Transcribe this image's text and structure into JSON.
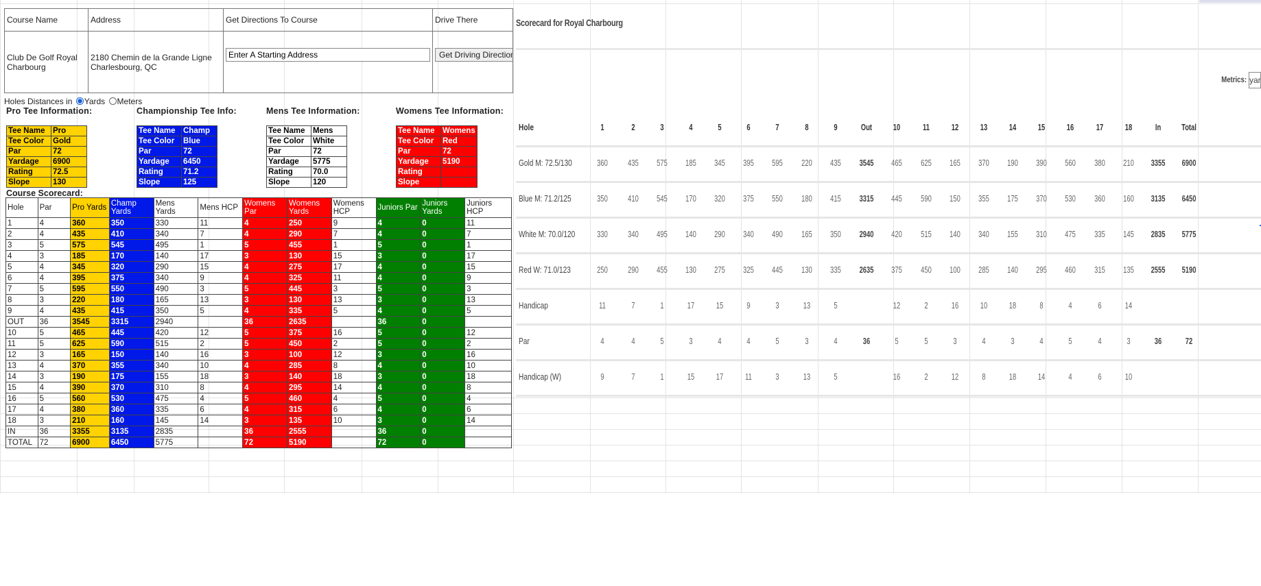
{
  "course_info": {
    "headers": [
      "Course Name",
      "Address",
      "Get Directions To Course",
      "Drive There"
    ],
    "course_name": "Club De Golf Royal Charbourg",
    "address_line1": "2180 Chemin de la Grande Ligne",
    "address_line2": "Charlesbourg, QC",
    "start_address_placeholder": "Enter A Starting Address",
    "directions_button": "Get Driving Directions"
  },
  "units": {
    "label": "Holes Distances in",
    "options": [
      "Yards",
      "Meters"
    ],
    "selected": "Yards"
  },
  "tees": [
    {
      "heading": "Pro Tee Information:",
      "color_class": "gold",
      "rows": [
        [
          "Tee Name",
          "Pro"
        ],
        [
          "Tee Color",
          "Gold"
        ],
        [
          "Par",
          "72"
        ],
        [
          "Yardage",
          "6900"
        ],
        [
          "Rating",
          "72.5"
        ],
        [
          "Slope",
          "130"
        ]
      ]
    },
    {
      "heading": "Championship Tee Info:",
      "color_class": "blue",
      "rows": [
        [
          "Tee Name",
          "Champ"
        ],
        [
          "Tee Color",
          "Blue"
        ],
        [
          "Par",
          "72"
        ],
        [
          "Yardage",
          "6450"
        ],
        [
          "Rating",
          "71.2"
        ],
        [
          "Slope",
          "125"
        ]
      ]
    },
    {
      "heading": "Mens Tee Information:",
      "color_class": "white",
      "rows": [
        [
          "Tee Name",
          "Mens"
        ],
        [
          "Tee Color",
          "White"
        ],
        [
          "Par",
          "72"
        ],
        [
          "Yardage",
          "5775"
        ],
        [
          "Rating",
          "70.0"
        ],
        [
          "Slope",
          "120"
        ]
      ]
    },
    {
      "heading": "Womens Tee Information:",
      "color_class": "red",
      "rows": [
        [
          "Tee Name",
          "Womens"
        ],
        [
          "Tee Color",
          "Red"
        ],
        [
          "Par",
          "72"
        ],
        [
          "Yardage",
          "5190"
        ],
        [
          "Rating",
          ""
        ],
        [
          "Slope",
          ""
        ]
      ]
    }
  ],
  "scorecard": {
    "title": "Course Scorecard:",
    "columns": [
      "Hole",
      "Par",
      "Pro Yards",
      "Champ Yards",
      "Mens Yards",
      "Mens HCP",
      "Womens Par",
      "Womens Yards",
      "Womens HCP",
      "Juniors Par",
      "Juniors Yards",
      "Juniors HCP"
    ],
    "rows": [
      [
        "1",
        "4",
        "360",
        "350",
        "330",
        "11",
        "4",
        "250",
        "9",
        "4",
        "0",
        "11"
      ],
      [
        "2",
        "4",
        "435",
        "410",
        "340",
        "7",
        "4",
        "290",
        "7",
        "4",
        "0",
        "7"
      ],
      [
        "3",
        "5",
        "575",
        "545",
        "495",
        "1",
        "5",
        "455",
        "1",
        "5",
        "0",
        "1"
      ],
      [
        "4",
        "3",
        "185",
        "170",
        "140",
        "17",
        "3",
        "130",
        "15",
        "3",
        "0",
        "17"
      ],
      [
        "5",
        "4",
        "345",
        "320",
        "290",
        "15",
        "4",
        "275",
        "17",
        "4",
        "0",
        "15"
      ],
      [
        "6",
        "4",
        "395",
        "375",
        "340",
        "9",
        "4",
        "325",
        "11",
        "4",
        "0",
        "9"
      ],
      [
        "7",
        "5",
        "595",
        "550",
        "490",
        "3",
        "5",
        "445",
        "3",
        "5",
        "0",
        "3"
      ],
      [
        "8",
        "3",
        "220",
        "180",
        "165",
        "13",
        "3",
        "130",
        "13",
        "3",
        "0",
        "13"
      ],
      [
        "9",
        "4",
        "435",
        "415",
        "350",
        "5",
        "4",
        "335",
        "5",
        "4",
        "0",
        "5"
      ],
      [
        "OUT",
        "36",
        "3545",
        "3315",
        "2940",
        "",
        "36",
        "2635",
        "",
        "36",
        "0",
        ""
      ],
      [
        "10",
        "5",
        "465",
        "445",
        "420",
        "12",
        "5",
        "375",
        "16",
        "5",
        "0",
        "12"
      ],
      [
        "11",
        "5",
        "625",
        "590",
        "515",
        "2",
        "5",
        "450",
        "2",
        "5",
        "0",
        "2"
      ],
      [
        "12",
        "3",
        "165",
        "150",
        "140",
        "16",
        "3",
        "100",
        "12",
        "3",
        "0",
        "16"
      ],
      [
        "13",
        "4",
        "370",
        "355",
        "340",
        "10",
        "4",
        "285",
        "8",
        "4",
        "0",
        "10"
      ],
      [
        "14",
        "3",
        "190",
        "175",
        "155",
        "18",
        "3",
        "140",
        "18",
        "3",
        "0",
        "18"
      ],
      [
        "15",
        "4",
        "390",
        "370",
        "310",
        "8",
        "4",
        "295",
        "14",
        "4",
        "0",
        "8"
      ],
      [
        "16",
        "5",
        "560",
        "530",
        "475",
        "4",
        "5",
        "460",
        "4",
        "5",
        "0",
        "4"
      ],
      [
        "17",
        "4",
        "380",
        "360",
        "335",
        "6",
        "4",
        "315",
        "6",
        "4",
        "0",
        "6"
      ],
      [
        "18",
        "3",
        "210",
        "160",
        "145",
        "14",
        "3",
        "135",
        "10",
        "3",
        "0",
        "14"
      ],
      [
        "IN",
        "36",
        "3355",
        "3135",
        "2835",
        "",
        "36",
        "2555",
        "",
        "36",
        "0",
        ""
      ],
      [
        "TOTAL",
        "72",
        "6900",
        "6450",
        "5775",
        "",
        "72",
        "5190",
        "",
        "72",
        "0",
        ""
      ]
    ]
  },
  "right_panel": {
    "title": "Scorecard for Royal Charbourg",
    "metrics_label": "Metrics:",
    "metrics_value": "yards",
    "header": [
      "Hole",
      "1",
      "2",
      "3",
      "4",
      "5",
      "6",
      "7",
      "8",
      "9",
      "Out",
      "10",
      "11",
      "12",
      "13",
      "14",
      "15",
      "16",
      "17",
      "18",
      "In",
      "Total"
    ],
    "rows": [
      [
        "Gold M: 72.5/130",
        "360",
        "435",
        "575",
        "185",
        "345",
        "395",
        "595",
        "220",
        "435",
        "3545",
        "465",
        "625",
        "165",
        "370",
        "190",
        "390",
        "560",
        "380",
        "210",
        "3355",
        "6900"
      ],
      [
        "Blue M: 71.2/125",
        "350",
        "410",
        "545",
        "170",
        "320",
        "375",
        "550",
        "180",
        "415",
        "3315",
        "445",
        "590",
        "150",
        "355",
        "175",
        "370",
        "530",
        "360",
        "160",
        "3135",
        "6450"
      ],
      [
        "White M: 70.0/120",
        "330",
        "340",
        "495",
        "140",
        "290",
        "340",
        "490",
        "165",
        "350",
        "2940",
        "420",
        "515",
        "140",
        "340",
        "155",
        "310",
        "475",
        "335",
        "145",
        "2835",
        "5775"
      ],
      [
        "Red W: 71.0/123",
        "250",
        "290",
        "455",
        "130",
        "275",
        "325",
        "445",
        "130",
        "335",
        "2635",
        "375",
        "450",
        "100",
        "285",
        "140",
        "295",
        "460",
        "315",
        "135",
        "2555",
        "5190"
      ],
      [
        "Handicap",
        "11",
        "7",
        "1",
        "17",
        "15",
        "9",
        "3",
        "13",
        "5",
        "",
        "12",
        "2",
        "16",
        "10",
        "18",
        "8",
        "4",
        "6",
        "14",
        "",
        ""
      ],
      [
        "Par",
        "4",
        "4",
        "5",
        "3",
        "4",
        "4",
        "5",
        "3",
        "4",
        "36",
        "5",
        "5",
        "3",
        "4",
        "3",
        "4",
        "5",
        "4",
        "3",
        "36",
        "72"
      ],
      [
        "Handicap (W)",
        "9",
        "7",
        "1",
        "15",
        "17",
        "11",
        "3",
        "13",
        "5",
        "",
        "16",
        "2",
        "12",
        "8",
        "18",
        "14",
        "4",
        "6",
        "10",
        "",
        ""
      ]
    ]
  }
}
